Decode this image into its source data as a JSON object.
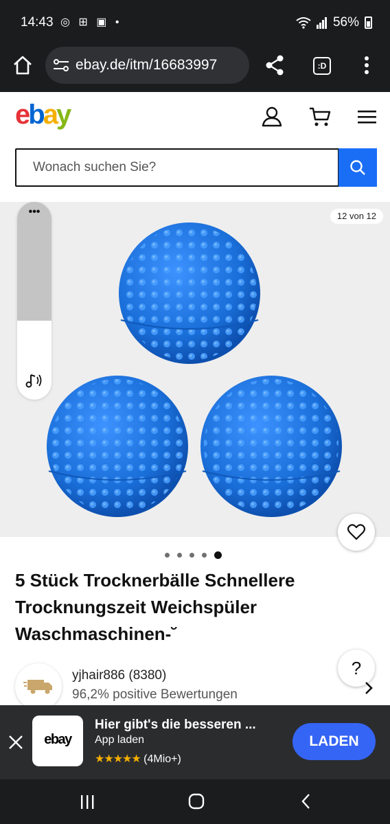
{
  "status_bar": {
    "time": "14:43",
    "left_icons": "◎ ⊞ ▣ •",
    "battery_text": "56%"
  },
  "browser": {
    "url": "ebay.de/itm/16683997",
    "icons": [
      "home-icon",
      "site-settings-icon",
      "share-icon",
      "tab-switcher-icon",
      "overflow-menu-icon"
    ],
    "tab_badge": ":D"
  },
  "header": {
    "logo_letters": [
      {
        "char": "e",
        "color": "#e53238"
      },
      {
        "char": "b",
        "color": "#0064d2"
      },
      {
        "char": "a",
        "color": "#f5af02"
      },
      {
        "char": "y",
        "color": "#86b817"
      }
    ],
    "search_placeholder": "Wonach suchen Sie?"
  },
  "gallery": {
    "counter": "12 von 12",
    "image_description": "three-blue-spiked-dryer-balls",
    "ball_color": "#1a6ed8",
    "dots_total": 5,
    "dots_active": 5
  },
  "volume_panel": {
    "more_label": "•••",
    "level": 0.4
  },
  "product": {
    "title": "5 Stück Trocknerbälle Schnellere Trocknungszeit Weichspüler Waschmaschinen-˘"
  },
  "seller": {
    "name": "yjhair886 (8380)",
    "rating": "96,2% positive Bewertungen",
    "help_label": "?"
  },
  "app_banner": {
    "title": "Hier gibt's die besseren ...",
    "subtitle": "App laden",
    "stars": "★★★★★",
    "rating_count": "(4Mio+)",
    "button_label": "LADEN",
    "app_logo_text": "ebay"
  },
  "colors": {
    "accent_blue": "#1a6ef5",
    "laden_blue": "#3565f5",
    "star_yellow": "#f5af02"
  }
}
